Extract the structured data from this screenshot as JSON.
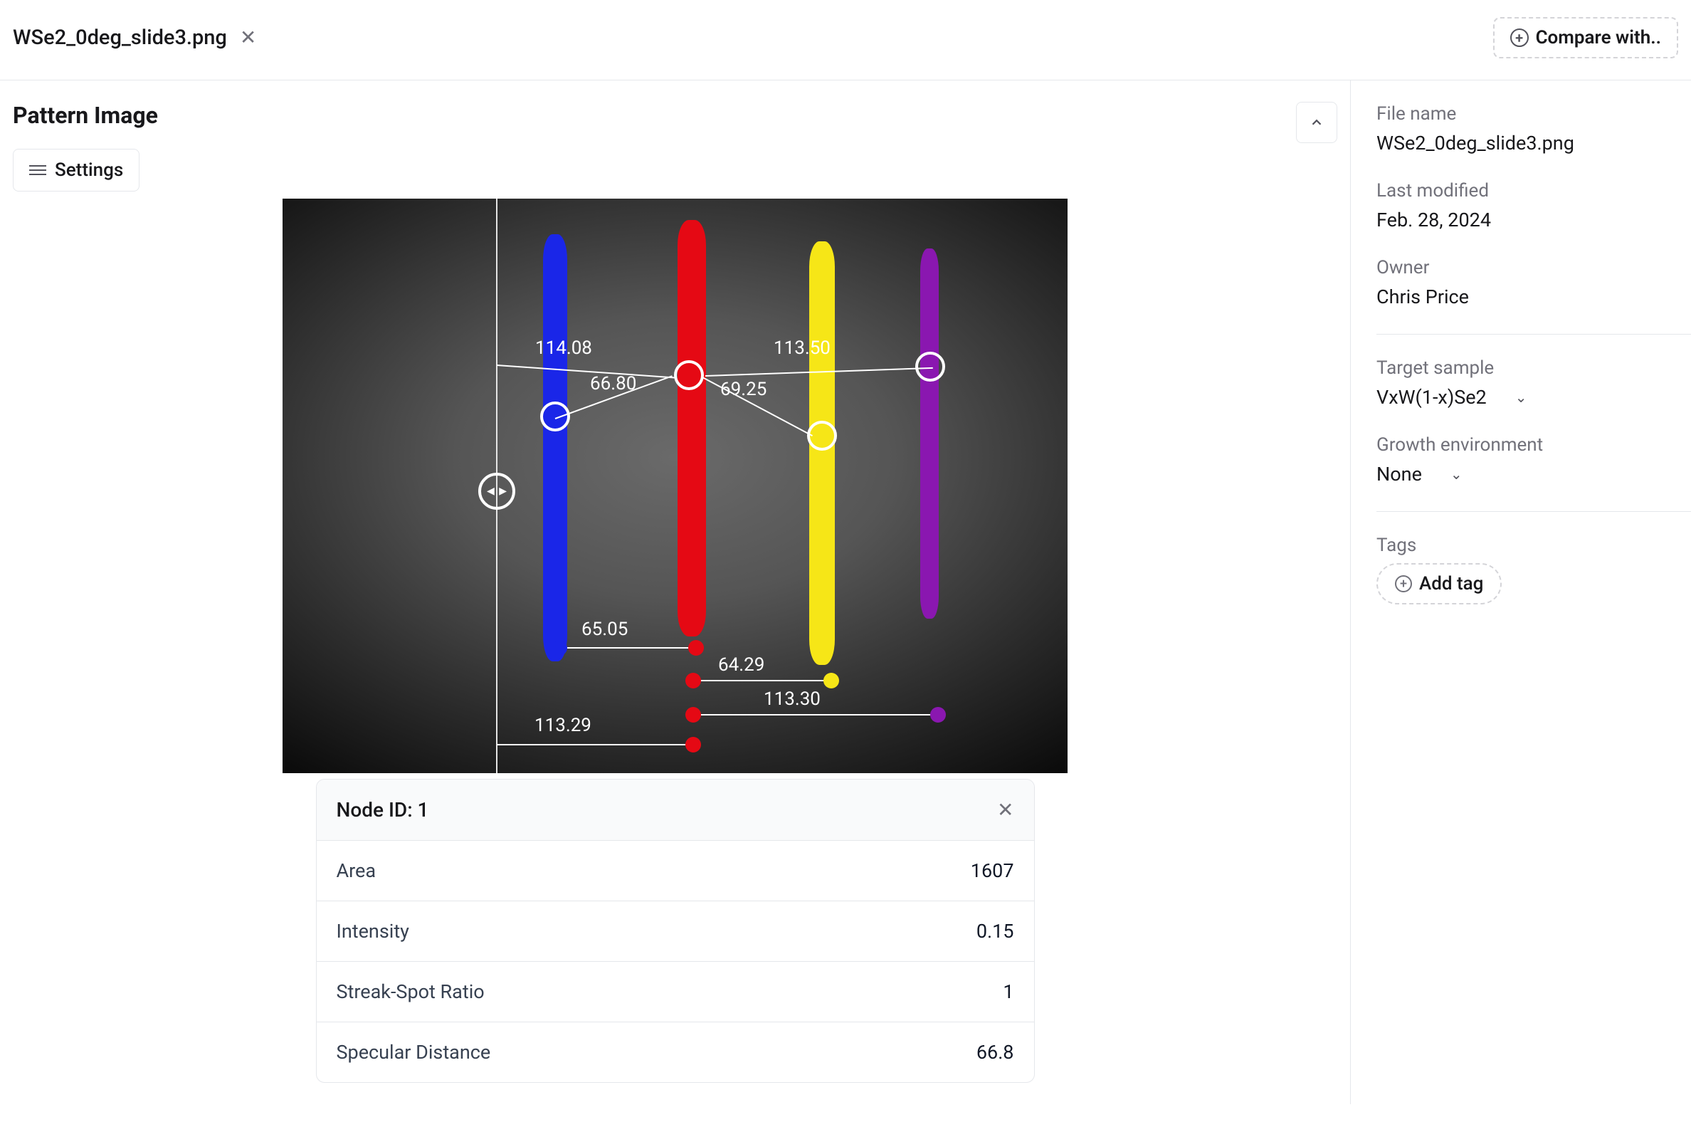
{
  "header": {
    "filename": "WSe2_0deg_slide3.png",
    "compare_label": "Compare with.."
  },
  "section": {
    "title": "Pattern Image",
    "settings_label": "Settings"
  },
  "measurements": {
    "m1": "114.08",
    "m2": "66.80",
    "m3": "69.25",
    "m4": "113.50",
    "m5": "65.05",
    "m6": "64.29",
    "m7": "113.30",
    "m8": "113.29"
  },
  "node_panel": {
    "title": "Node ID: 1",
    "rows": [
      {
        "label": "Area",
        "value": "1607"
      },
      {
        "label": "Intensity",
        "value": "0.15"
      },
      {
        "label": "Streak-Spot Ratio",
        "value": "1"
      },
      {
        "label": "Specular Distance",
        "value": "66.8"
      }
    ]
  },
  "sidebar": {
    "file_name_label": "File name",
    "file_name": "WSe2_0deg_slide3.png",
    "last_modified_label": "Last modified",
    "last_modified": "Feb. 28, 2024",
    "owner_label": "Owner",
    "owner": "Chris Price",
    "target_sample_label": "Target sample",
    "target_sample": "VxW(1-x)Se2",
    "growth_env_label": "Growth environment",
    "growth_env": "None",
    "tags_label": "Tags",
    "add_tag_label": "Add tag"
  }
}
